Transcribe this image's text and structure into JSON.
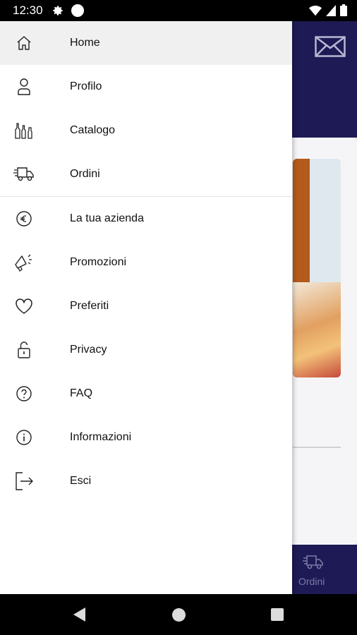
{
  "status_bar": {
    "time": "12:30",
    "icons": [
      "gear-icon",
      "notification-dot",
      "wifi-icon",
      "signal-icon",
      "battery-icon"
    ]
  },
  "background_app": {
    "bottom_nav_label": "Ordini",
    "icons": [
      "mail-icon",
      "truck-icon"
    ],
    "colors": {
      "header": "#1e1a55",
      "background": "#e9e9ec"
    }
  },
  "drawer": {
    "items": [
      {
        "label": "Home",
        "icon": "home-icon",
        "active": true
      },
      {
        "label": "Profilo",
        "icon": "person-icon"
      },
      {
        "label": "Catalogo",
        "icon": "bottles-icon"
      },
      {
        "label": "Ordini",
        "icon": "truck-icon"
      },
      {
        "label": "La tua azienda",
        "icon": "euro-icon"
      },
      {
        "label": "Promozioni",
        "icon": "megaphone-icon"
      },
      {
        "label": "Preferiti",
        "icon": "heart-icon"
      },
      {
        "label": "Privacy",
        "icon": "lock-icon"
      },
      {
        "label": "FAQ",
        "icon": "question-icon"
      },
      {
        "label": "Informazioni",
        "icon": "info-icon"
      },
      {
        "label": "Esci",
        "icon": "logout-icon"
      }
    ],
    "colors": {
      "active_background": "#f0f0f0",
      "text": "#111111"
    }
  },
  "navigation_bar": {
    "icons": [
      "back-icon",
      "home-button-icon",
      "recents-icon"
    ]
  }
}
